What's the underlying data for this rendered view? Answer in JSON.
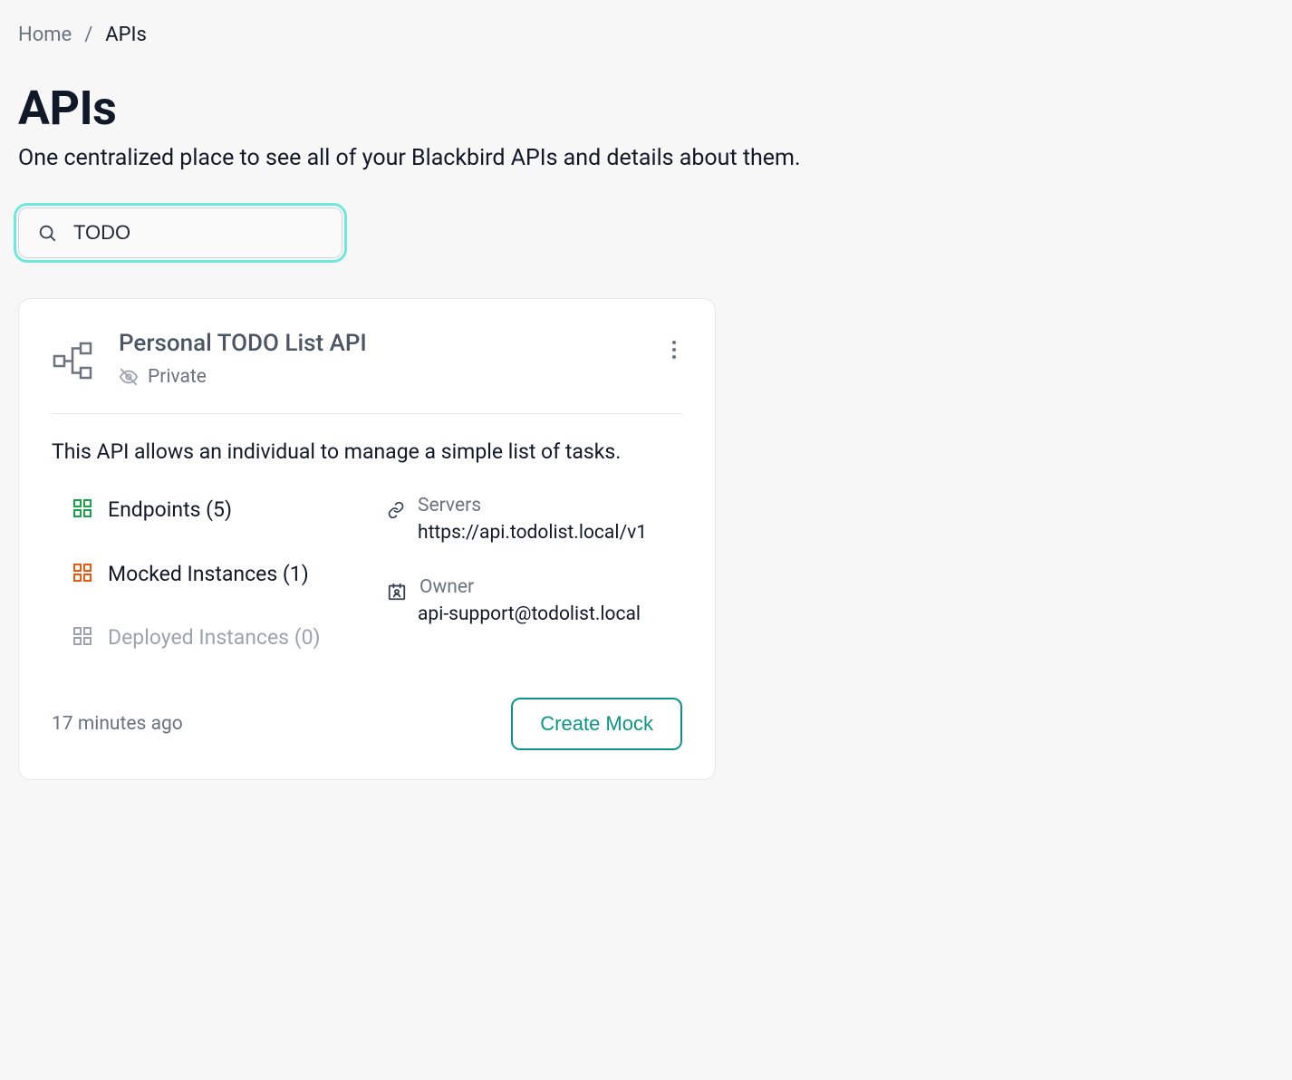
{
  "breadcrumb": {
    "home": "Home",
    "separator": "/",
    "current": "APIs"
  },
  "page": {
    "title": "APIs",
    "subtitle": "One centralized place to see all of your Blackbird APIs and details about them."
  },
  "search": {
    "value": "TODO"
  },
  "card": {
    "title": "Personal TODO List API",
    "visibility": "Private",
    "description": "This API allows an individual to manage a simple list of tasks.",
    "endpoints_label": "Endpoints (5)",
    "mocked_label": "Mocked Instances (1)",
    "deployed_label": "Deployed Instances (0)",
    "servers_label": "Servers",
    "servers_value": "https://api.todolist.local/v1",
    "owner_label": "Owner",
    "owner_value": "api-support@todolist.local",
    "timestamp": "17 minutes ago",
    "create_mock": "Create Mock"
  }
}
